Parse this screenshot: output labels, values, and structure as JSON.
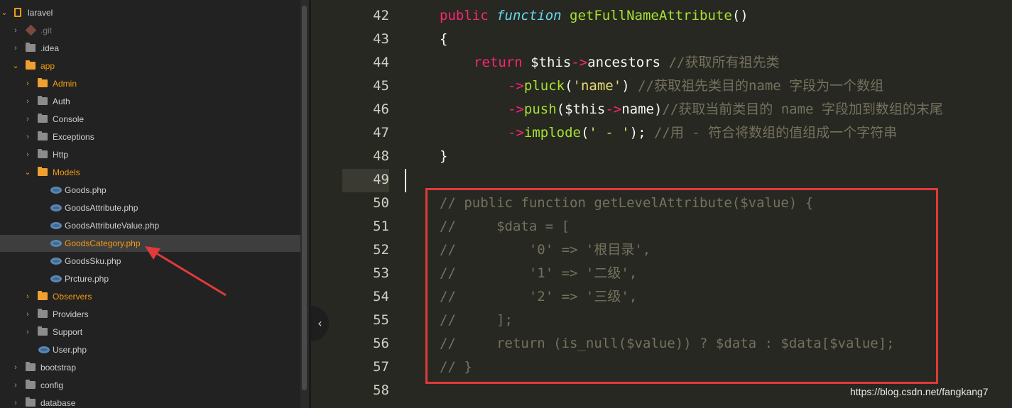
{
  "sidebar": {
    "items": [
      {
        "label": "laravel",
        "kind": "repo",
        "open": true
      },
      {
        "label": ".git",
        "kind": "git"
      },
      {
        "label": ".idea",
        "kind": "folder"
      },
      {
        "label": "app",
        "kind": "folder",
        "open": true,
        "orange": true
      },
      {
        "label": "Admin",
        "kind": "folder",
        "orange": true
      },
      {
        "label": "Auth",
        "kind": "folder"
      },
      {
        "label": "Console",
        "kind": "folder"
      },
      {
        "label": "Exceptions",
        "kind": "folder"
      },
      {
        "label": "Http",
        "kind": "folder"
      },
      {
        "label": "Models",
        "kind": "folder",
        "open": true,
        "orange": true
      },
      {
        "label": "Goods.php",
        "kind": "php"
      },
      {
        "label": "GoodsAttribute.php",
        "kind": "php"
      },
      {
        "label": "GoodsAttributeValue.php",
        "kind": "php"
      },
      {
        "label": "GoodsCategory.php",
        "kind": "php",
        "selected": true
      },
      {
        "label": "GoodsSku.php",
        "kind": "php"
      },
      {
        "label": "Prcture.php",
        "kind": "php"
      },
      {
        "label": "Observers",
        "kind": "folder",
        "orange": true
      },
      {
        "label": "Providers",
        "kind": "folder"
      },
      {
        "label": "Support",
        "kind": "folder"
      },
      {
        "label": "User.php",
        "kind": "php"
      },
      {
        "label": "bootstrap",
        "kind": "folder"
      },
      {
        "label": "config",
        "kind": "folder"
      },
      {
        "label": "database",
        "kind": "folder"
      }
    ]
  },
  "editor": {
    "line_numbers": [
      "42",
      "43",
      "44",
      "45",
      "46",
      "47",
      "48",
      "49",
      "50",
      "51",
      "52",
      "53",
      "54",
      "55",
      "56",
      "57",
      "58"
    ],
    "current_line": "49",
    "code": {
      "l42": {
        "public": "public ",
        "function": "function ",
        "name": "getFullNameAttribute",
        "rest": "()"
      },
      "l43": "{",
      "l44": {
        "return": "return ",
        "this": "$this",
        "arrow": "->",
        "prop": "ancestors ",
        "comment": "//获取所有祖先类"
      },
      "l45": {
        "arrow": "->",
        "fn": "pluck",
        "open": "(",
        "str": "'name'",
        "close": ") ",
        "comment": "//获取祖先类目的name 字段为一个数组"
      },
      "l46": {
        "arrow": "->",
        "fn": "push",
        "open": "(",
        "this": "$this",
        "arrow2": "->",
        "prop": "name",
        "close": ")",
        "comment": "//获取当前类目的 name 字段加到数组的末尾"
      },
      "l47": {
        "arrow": "->",
        "fn": "implode",
        "open": "(",
        "str": "' - '",
        "close": "); ",
        "comment": "//用 - 符合将数组的值组成一个字符串"
      },
      "l48": "}",
      "l50": "// public function getLevelAttribute($value) {",
      "l51": "//     $data = [",
      "l52": "//         '0' => '根目录',",
      "l53": "//         '1' => '二级',",
      "l54": "//         '2' => '三级',",
      "l55": "//     ];",
      "l56": "//     return (is_null($value)) ? $data : $data[$value];",
      "l57": "// }"
    }
  },
  "collapse_glyph": "‹",
  "watermark": "https://blog.csdn.net/fangkang7",
  "colors": {
    "keyword": "#f92672",
    "function": "#a6e22e",
    "string": "#e6db74",
    "comment": "#75715e",
    "annotation": "#e03a3a"
  }
}
